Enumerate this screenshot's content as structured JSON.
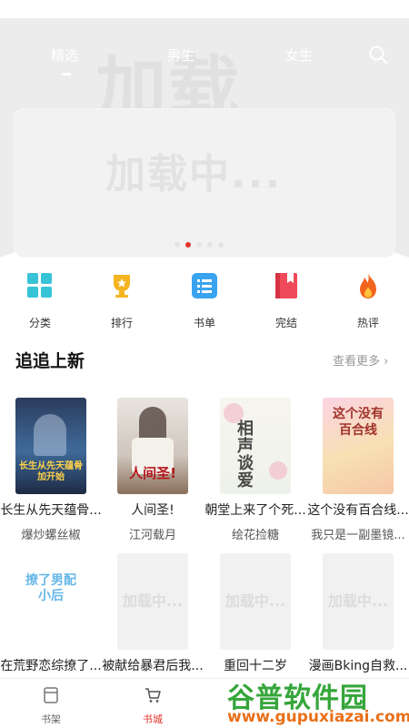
{
  "top_tabs": [
    {
      "label": "精选",
      "active": true
    },
    {
      "label": "男生",
      "active": false
    },
    {
      "label": "女生",
      "active": false
    }
  ],
  "hero_watermark": "加载",
  "banner": {
    "placeholder_text": "加载中...",
    "dots_total": 5,
    "active_dot": 2
  },
  "categories": [
    {
      "label": "分类",
      "icon": "grid-icon",
      "color": "#37c3d6"
    },
    {
      "label": "排行",
      "icon": "trophy-icon",
      "color": "#f5b41f"
    },
    {
      "label": "书单",
      "icon": "list-icon",
      "color": "#3aa3f0"
    },
    {
      "label": "完结",
      "icon": "bookmark-book-icon",
      "color": "#ef4a5a"
    },
    {
      "label": "热评",
      "icon": "flame-icon",
      "color": "#f2641e"
    }
  ],
  "section": {
    "title": "追追上新",
    "more_label": "查看更多 ›"
  },
  "books_row1": [
    {
      "title": "长生从先天蕴骨...",
      "author": "爆炒螺丝椒",
      "cover_text": "长生从先天蕴骨加开始"
    },
    {
      "title": "人间圣!",
      "author": "江河载月",
      "cover_text": "人间圣!"
    },
    {
      "title": "朝堂上来了个死...",
      "author": "绘花捡糖",
      "cover_text": "相声谈爱"
    },
    {
      "title": "这个没有百合线...",
      "author": "我只是一副墨镜...",
      "cover_text": "这个没有百合线"
    }
  ],
  "books_row2": [
    {
      "title": "在荒野恋综撩了...",
      "cover_text": "撩了男配小后"
    },
    {
      "title": "被献给暴君后我...",
      "cover_text": "加载中..."
    },
    {
      "title": "重回十二岁",
      "cover_text": "加载中..."
    },
    {
      "title": "漫画Bking自救...",
      "cover_text": "加载中..."
    }
  ],
  "bottom_tabs": [
    {
      "label": "书架",
      "icon": "bookshelf-icon",
      "active": false
    },
    {
      "label": "书城",
      "icon": "cart-icon",
      "active": true
    }
  ],
  "watermark_brand": {
    "name": "谷普软件园",
    "url": "www.gupuxiazai.com"
  },
  "colors": {
    "accent": "#e3342a",
    "brand_green": "#35a63a",
    "brand_orange": "#e8701a"
  }
}
